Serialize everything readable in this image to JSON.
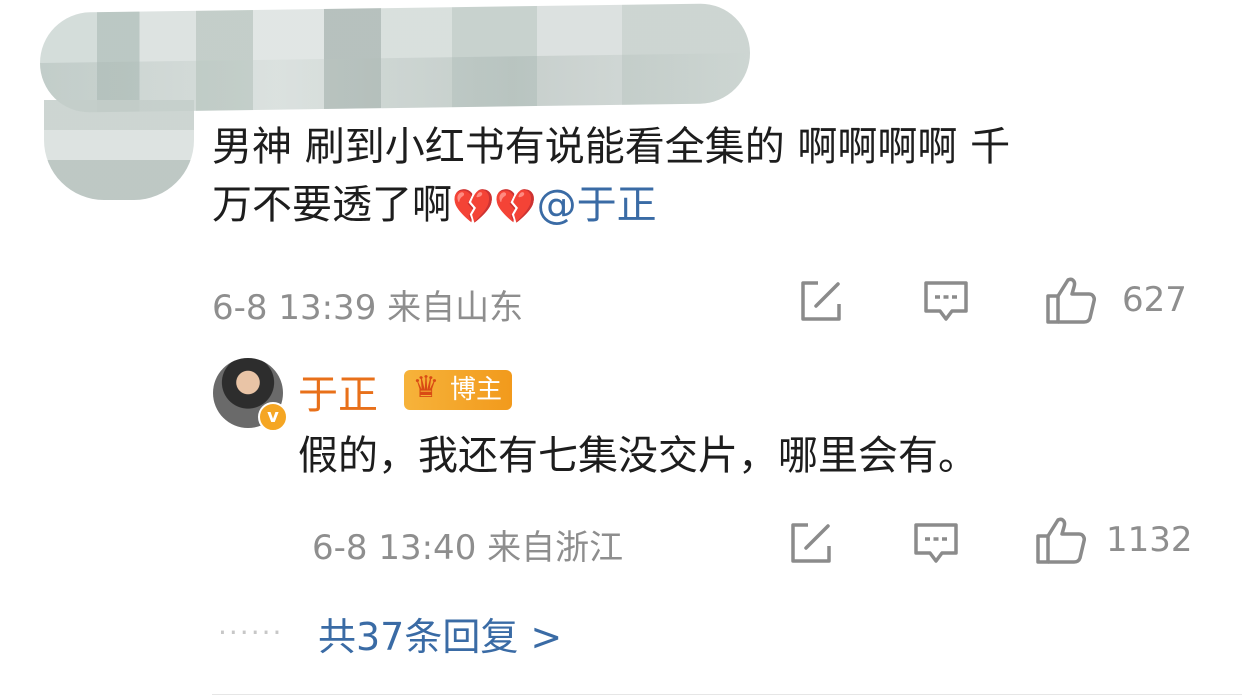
{
  "comment": {
    "text_line1": "男神 刷到小红书有说能看全集的 啊啊啊啊 千",
    "text_line2": "万不要透了啊",
    "hearts": "💔💔",
    "mention": "@于正",
    "time": "6-8 13:39",
    "location": "来自山东",
    "likes": "627"
  },
  "reply": {
    "author": "于正",
    "badge_label": "博主",
    "verified_mark": "v",
    "text": "假的，我还有七集没交片，哪里会有。",
    "time": "6-8 13:40",
    "location": "来自浙江",
    "likes": "1132"
  },
  "more_replies": {
    "dots": "······",
    "label": "共37条回复 >"
  },
  "icons": {
    "share": "share-edit-icon",
    "comment": "comment-bubble-icon",
    "like": "thumbs-up-icon"
  },
  "colors": {
    "mention": "#3a6ba5",
    "author": "#e8701a",
    "badge": "#f29a1c",
    "meta": "#8e8e8e"
  }
}
